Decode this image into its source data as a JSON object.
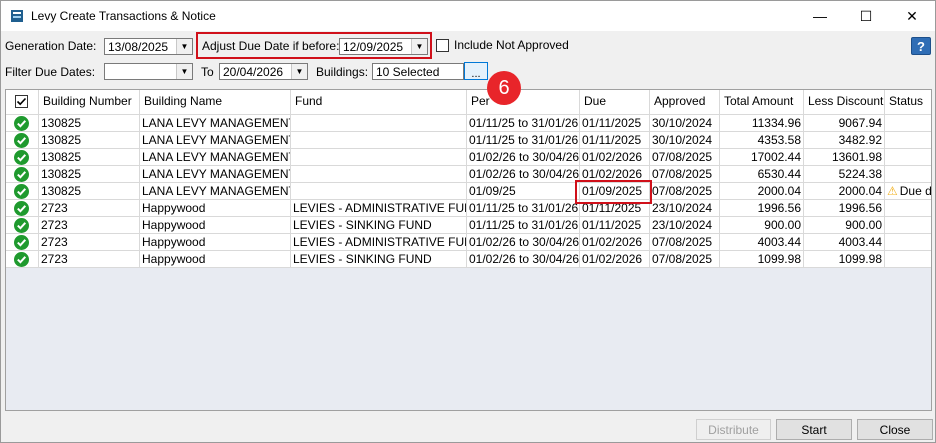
{
  "window": {
    "title": "Levy Create Transactions & Notice",
    "minimize": "—",
    "maximize": "☐",
    "close": "✕"
  },
  "toolbar": {
    "generation_date_label": "Generation Date:",
    "generation_date": "13/08/2025",
    "adjust_due_label": "Adjust Due Date if before:",
    "adjust_due_date": "12/09/2025",
    "include_not_approved_label": "Include Not Approved",
    "filter_due_label": "Filter Due Dates:",
    "filter_from": "",
    "to_label": "To",
    "filter_to": "20/04/2026",
    "buildings_label": "Buildings:",
    "buildings_value": "10 Selected",
    "browse_label": "...",
    "help_label": "?"
  },
  "annotation": {
    "step": "6"
  },
  "grid": {
    "columns": [
      "",
      "Building Number",
      "Building Name",
      "Fund",
      "Per",
      "Due",
      "Approved",
      "Total Amount",
      "Less Discount",
      "Status"
    ],
    "rows": [
      {
        "building_number": "130825",
        "building_name": "LANA LEVY MANAGEMENT",
        "fund": "",
        "period": "01/11/25 to 31/01/26",
        "due": "01/11/2025",
        "approved": "30/10/2024",
        "total": "11334.96",
        "discount": "9067.94",
        "status": ""
      },
      {
        "building_number": "130825",
        "building_name": "LANA LEVY MANAGEMENT",
        "fund": "",
        "period": "01/11/25 to 31/01/26",
        "due": "01/11/2025",
        "approved": "30/10/2024",
        "total": "4353.58",
        "discount": "3482.92",
        "status": ""
      },
      {
        "building_number": "130825",
        "building_name": "LANA LEVY MANAGEMENT",
        "fund": "",
        "period": "01/02/26 to 30/04/26",
        "due": "01/02/2026",
        "approved": "07/08/2025",
        "total": "17002.44",
        "discount": "13601.98",
        "status": ""
      },
      {
        "building_number": "130825",
        "building_name": "LANA LEVY MANAGEMENT",
        "fund": "",
        "period": "01/02/26 to 30/04/26",
        "due": "01/02/2026",
        "approved": "07/08/2025",
        "total": "6530.44",
        "discount": "5224.38",
        "status": ""
      },
      {
        "building_number": "130825",
        "building_name": "LANA LEVY MANAGEMENT",
        "fund": "",
        "period": "01/09/25",
        "due": "01/09/2025",
        "approved": "07/08/2025",
        "total": "2000.04",
        "discount": "2000.04",
        "status": "Due d"
      },
      {
        "building_number": "2723",
        "building_name": "Happywood",
        "fund": "LEVIES - ADMINISTRATIVE FUND",
        "period": "01/11/25 to 31/01/26",
        "due": "01/11/2025",
        "approved": "23/10/2024",
        "total": "1996.56",
        "discount": "1996.56",
        "status": ""
      },
      {
        "building_number": "2723",
        "building_name": "Happywood",
        "fund": "LEVIES - SINKING FUND",
        "period": "01/11/25 to 31/01/26",
        "due": "01/11/2025",
        "approved": "23/10/2024",
        "total": "900.00",
        "discount": "900.00",
        "status": ""
      },
      {
        "building_number": "2723",
        "building_name": "Happywood",
        "fund": "LEVIES - ADMINISTRATIVE FUND",
        "period": "01/02/26 to 30/04/26",
        "due": "01/02/2026",
        "approved": "07/08/2025",
        "total": "4003.44",
        "discount": "4003.44",
        "status": ""
      },
      {
        "building_number": "2723",
        "building_name": "Happywood",
        "fund": "LEVIES - SINKING FUND",
        "period": "01/02/26 to 30/04/26",
        "due": "01/02/2026",
        "approved": "07/08/2025",
        "total": "1099.98",
        "discount": "1099.98",
        "status": ""
      }
    ]
  },
  "buttons": {
    "distribute": "Distribute",
    "start": "Start",
    "close": "Close"
  },
  "colors": {
    "highlight": "#d0101a",
    "badge": "#e8252a",
    "ok": "#1f9a2e",
    "warning": "#f2b01e"
  },
  "icons": {
    "row_status": "check-circle-icon",
    "warning": "warning-icon",
    "app": "app-icon"
  }
}
